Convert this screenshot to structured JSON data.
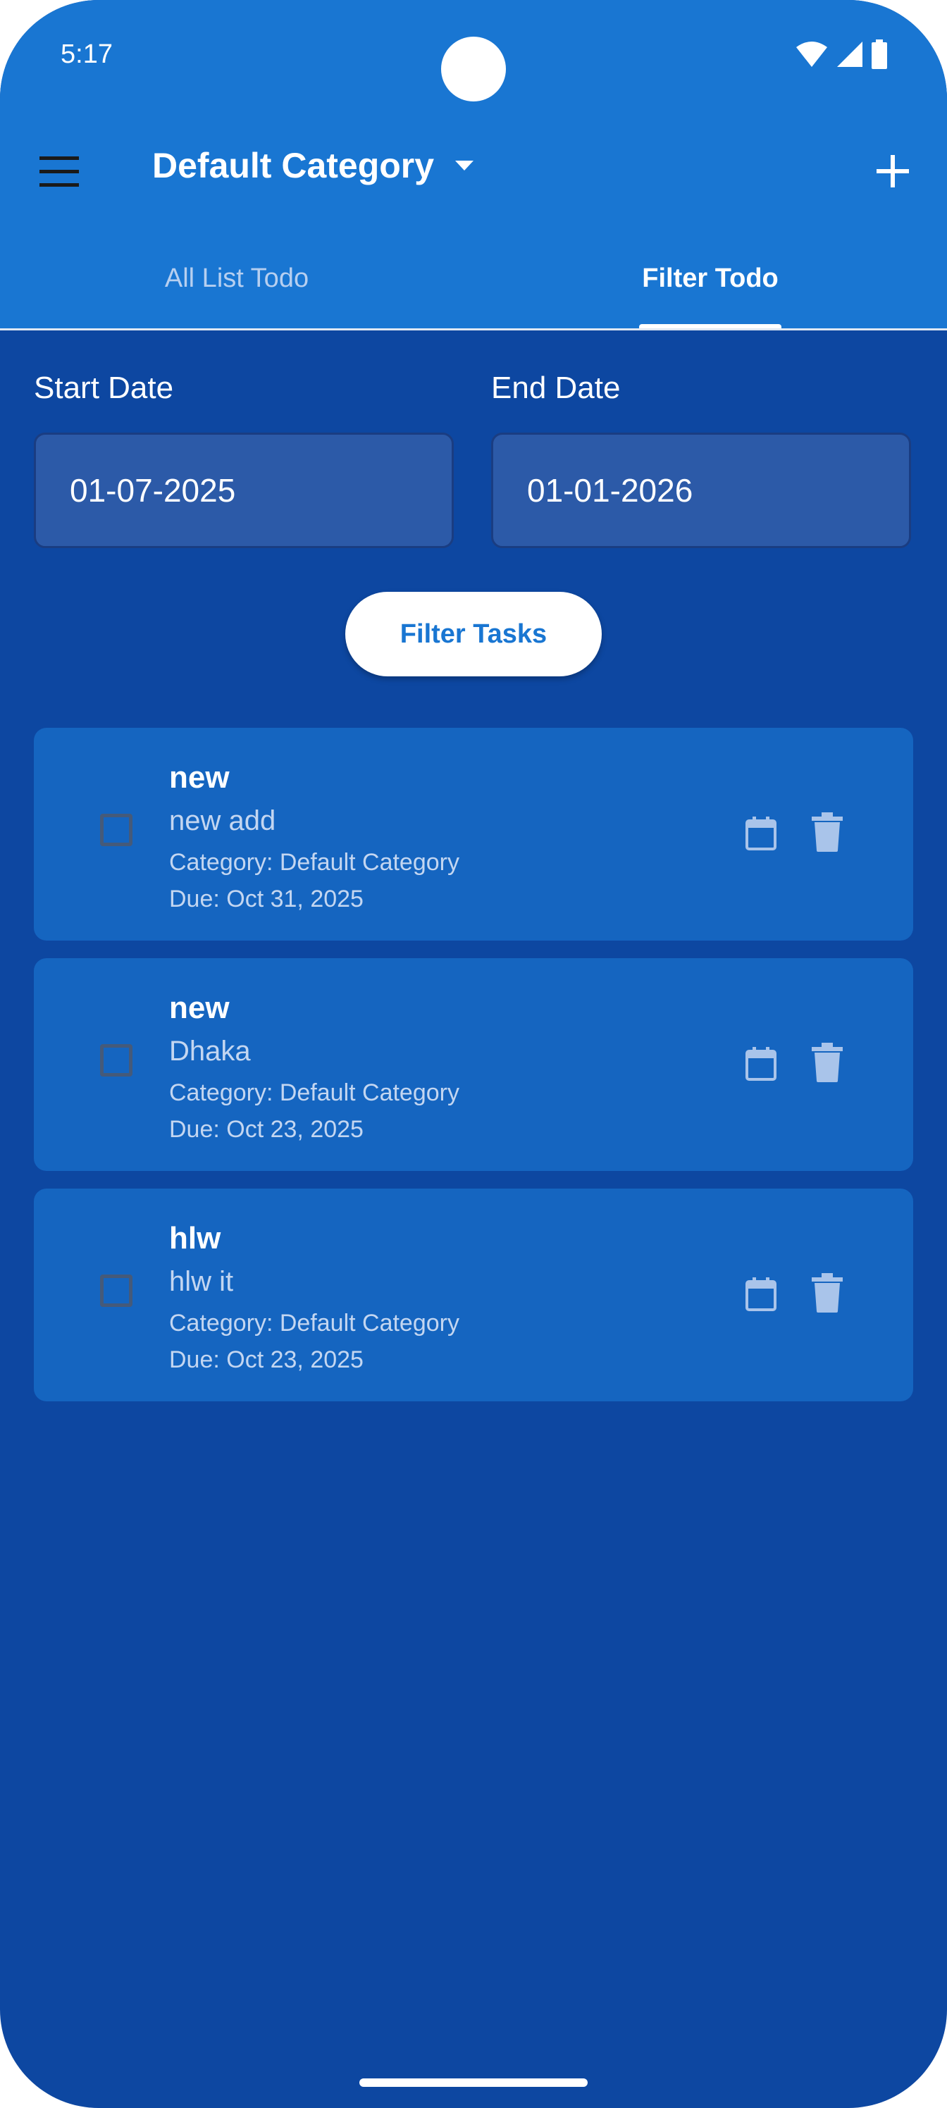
{
  "status_bar": {
    "time": "5:17"
  },
  "app_bar": {
    "title": "Default Category",
    "menu_icon": "menu-icon",
    "dropdown_icon": "caret-down-icon",
    "add_icon": "plus-icon"
  },
  "tabs": [
    {
      "label": "All List Todo",
      "selected": false
    },
    {
      "label": "Filter Todo",
      "selected": true
    }
  ],
  "filter": {
    "start_label": "Start Date",
    "start_value": "01-07-2025",
    "end_label": "End Date",
    "end_value": "01-01-2026",
    "button_label": "Filter Tasks"
  },
  "tasks": [
    {
      "title": "new",
      "description": "new add",
      "category": "Category: Default Category",
      "due": "Due: Oct 31, 2025",
      "done": false
    },
    {
      "title": "new",
      "description": "Dhaka",
      "category": "Category: Default Category",
      "due": "Due: Oct 23, 2025",
      "done": false
    },
    {
      "title": "hlw",
      "description": "hlw it",
      "category": "Category: Default Category",
      "due": "Due: Oct 23, 2025",
      "done": false
    }
  ],
  "colors": {
    "app_bar": "#1976d2",
    "background": "#0d47a1",
    "card": "#1565c0",
    "accent": "#ffffff"
  }
}
